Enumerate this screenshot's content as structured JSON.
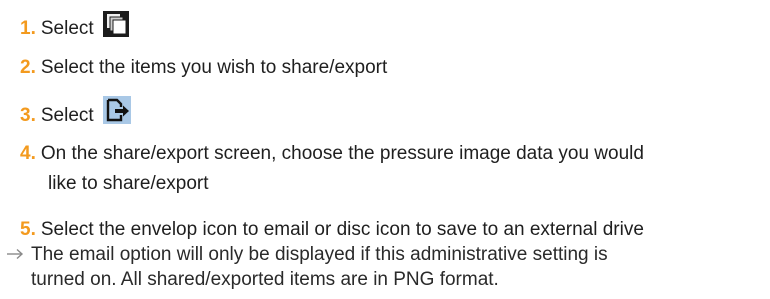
{
  "steps": [
    {
      "num": "1.",
      "text": "Select",
      "icon": "copy-stack-icon"
    },
    {
      "num": "2.",
      "text": "Select the items you wish to share/export"
    },
    {
      "num": "3.",
      "text": "Select",
      "icon": "export-icon"
    },
    {
      "num": "4.",
      "text": "On the share/export screen, choose the pressure image data you would",
      "text_cont": "like to share/export"
    },
    {
      "num": "5.",
      "text": "Select the envelop icon to email or disc icon to save to an external drive"
    }
  ],
  "note": {
    "arrow_icon": "right-arrow-icon",
    "line1": "The email option will only be displayed if this administrative setting is",
    "line2": "turned on.  All shared/exported items are in PNG format."
  },
  "colors": {
    "step_number": "#f39a1e",
    "icon_bg_dark": "#1c1c1c",
    "icon_bg_blue": "#a9c8e6"
  }
}
